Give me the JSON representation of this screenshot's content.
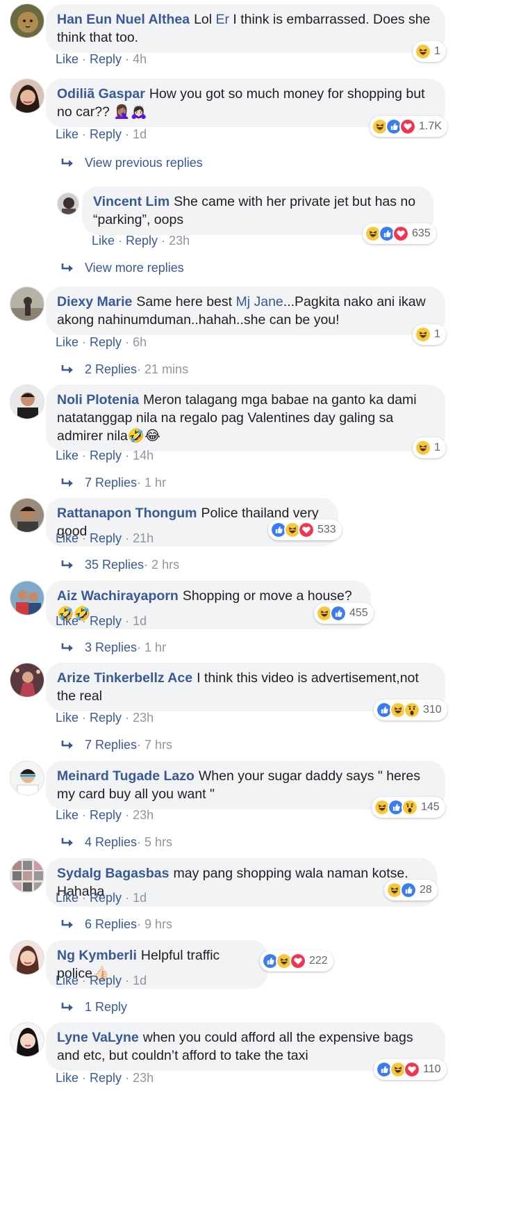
{
  "actions": {
    "like": "Like",
    "reply": "Reply",
    "sep": " · "
  },
  "colors": {
    "link": "#385898",
    "bubble": "#f2f3f5",
    "muted": "#90949c"
  },
  "comments": [
    {
      "author": "Han Eun Nuel Althea",
      "text_pre": "Lol ",
      "mention": "Er",
      "text_post": " I think is embarrassed. Does she think that too.",
      "time": "4h",
      "reactions": [
        "haha"
      ],
      "count": "1"
    },
    {
      "author": "Odiliã Gaspar",
      "text_pre": "How you got so much money for shopping but no car?? 🤦🏽‍♀️🙇🏻‍♀️",
      "time": "1d",
      "reactions": [
        "haha",
        "like",
        "love"
      ],
      "count": "1.7K"
    },
    {
      "author": "Vincent Lim",
      "text_pre": "She came with her private jet but has no “parking”, oops",
      "time": "23h",
      "reactions": [
        "haha",
        "like",
        "love"
      ],
      "count": "635"
    },
    {
      "author": "Diexy Marie",
      "text_pre": "Same here best ",
      "mention": "Mj Jane",
      "text_post": "...Pagkita nako ani ikaw akong nahinumduman..hahah..she can be you!",
      "time": "6h",
      "reactions": [
        "haha"
      ],
      "count": "1"
    },
    {
      "author": "Noli Plotenia",
      "text_pre": "Meron talagang mga babae na ganto ka dami natatanggap nila na regalo pag Valentines day galing sa admirer nila🤣😂",
      "time": "14h",
      "reactions": [
        "haha"
      ],
      "count": "1"
    },
    {
      "author": "Rattanapon Thongum",
      "text_pre": "Police thailand very good",
      "time": "21h",
      "reactions": [
        "like",
        "haha",
        "love"
      ],
      "count": "533"
    },
    {
      "author": "Aiz Wachirayaporn",
      "text_pre": "Shopping or move a house?🤣🤣",
      "time": "1d",
      "reactions": [
        "haha",
        "like"
      ],
      "count": "455"
    },
    {
      "author": "Arize Tinkerbellz Ace",
      "text_pre": "I think this video is advertisement,not the real",
      "time": "23h",
      "reactions": [
        "like",
        "haha",
        "wow"
      ],
      "count": "310"
    },
    {
      "author": "Meinard Tugade Lazo",
      "text_pre": "When your sugar daddy says \" heres my card buy all you want \"",
      "time": "23h",
      "reactions": [
        "haha",
        "like",
        "wow"
      ],
      "count": "145"
    },
    {
      "author": "Sydalg Bagasbas",
      "text_pre": "may pang shopping wala naman kotse. Hahaha",
      "time": "1d",
      "reactions": [
        "haha",
        "like"
      ],
      "count": "28"
    },
    {
      "author": "Ng Kymberli",
      "text_pre": "Helpful traffic police👍🏻",
      "time": "1d",
      "reactions": [
        "like",
        "haha",
        "love"
      ],
      "count": "222"
    },
    {
      "author": "Lyne VaLyne",
      "text_pre": "when you could afford all the expensive bags and etc, but couldn’t afford to take the taxi",
      "time": "23h",
      "reactions": [
        "like",
        "haha",
        "love"
      ],
      "count": "110"
    }
  ],
  "reply_links": [
    {
      "label": "View previous replies",
      "time": ""
    },
    {
      "label": "View more replies",
      "time": ""
    },
    {
      "label": "2 Replies",
      "time": " · 21 mins"
    },
    {
      "label": "7 Replies",
      "time": " · 1 hr"
    },
    {
      "label": "35 Replies",
      "time": " · 2 hrs"
    },
    {
      "label": "3 Replies",
      "time": " · 1 hr"
    },
    {
      "label": "7 Replies",
      "time": " · 7 hrs"
    },
    {
      "label": "4 Replies",
      "time": " · 5 hrs"
    },
    {
      "label": "6 Replies",
      "time": " · 9 hrs"
    },
    {
      "label": "1 Reply",
      "time": ""
    }
  ]
}
